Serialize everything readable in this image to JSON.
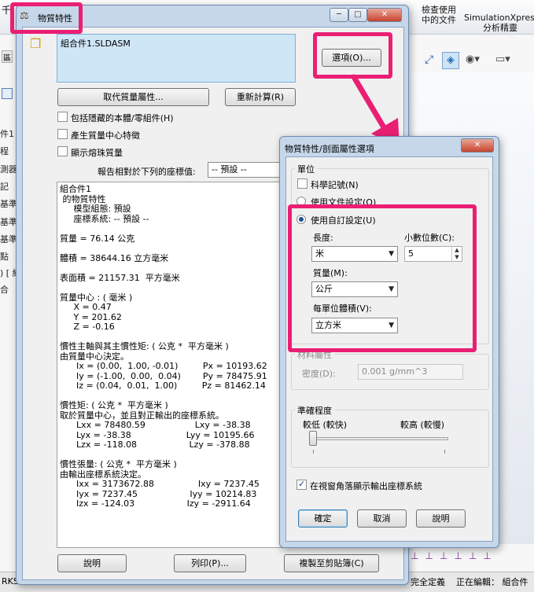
{
  "background_app": {
    "ribbon": {
      "left_partial": "千",
      "check_usage": [
        "檢查使用",
        "中的文件"
      ],
      "simulation": [
        "SimulationXpress",
        "分析精靈"
      ]
    },
    "tree_items": [
      "件1 (",
      "程",
      "測器",
      "記",
      "基準",
      "基準",
      "基準",
      "點",
      ") [ 組",
      "合"
    ],
    "status": {
      "left": "RKS",
      "fully_defined": "完全定義",
      "editing": "正在編輯：  組合件"
    },
    "left_tab": "區"
  },
  "mass_props": {
    "title": "物質特性",
    "document_name": "組合件1.SLDASM",
    "options_button": "選項(O)...",
    "override_button": "取代質量屬性...",
    "recalc_button": "重新計算(R)",
    "checkboxes": [
      {
        "label": "包括隱藏的本體/零組件(H)",
        "checked": false
      },
      {
        "label": "產生質量中心特徵",
        "checked": false
      },
      {
        "label": "顯示熔珠質量",
        "checked": false
      }
    ],
    "report_label": "報告相對於下列的座標值:",
    "coord_value": "-- 預設 --",
    "results": [
      "組合件1",
      " 的物質特性",
      "     模型組態: 預設",
      "     座標系統: -- 預設 --",
      "",
      "質量 = 76.14 公克",
      "",
      "體積 = 38644.16 立方毫米",
      "",
      "表面積 = 21157.31  平方毫米",
      "",
      "質量中心 : ( 毫米 )",
      "     X = 0.47",
      "     Y = 201.62",
      "     Z = -0.16",
      "",
      "慣性主軸與其主慣性矩: ( 公克 *  平方毫米 )",
      "由質量中心決定。",
      "      Ix = (0.00,  1.00, -0.01)         Px = 10193.62",
      "      Iy = (-1.00,  0.00,  0.04)        Py = 78475.91",
      "      Iz = (0.04,  0.01,  1.00)         Pz = 81462.14",
      "",
      "慣性矩: ( 公克 *  平方毫米 )",
      "取於質量中心，並且對正輸出的座標系統。",
      "      Lxx = 78480.59                  Lxy = -38.38",
      "      Lyx = -38.38                    Lyy = 10195.66",
      "      Lzx = -118.08                   Lzy = -378.88",
      "",
      "慣性張量: ( 公克 *  平方毫米 )",
      "由輸出座標系統決定。",
      "      Ixx = 3173672.88                Ixy = 7237.45",
      "      Iyx = 7237.45                   Iyy = 10214.83",
      "      Izx = -124.03                   Izy = -2911.64"
    ],
    "help_button": "說明",
    "print_button": "列印(P)...",
    "copy_button": "複製至剪貼簿(C)"
  },
  "options_dialog": {
    "title": "物質特性/剖面屬性選項",
    "units_group": "單位",
    "sci_notation": {
      "label": "科學記號(N)",
      "checked": false
    },
    "use_doc_settings": {
      "label": "使用文件設定(O)",
      "selected": false
    },
    "use_custom": {
      "label": "使用自訂設定(U)",
      "selected": true
    },
    "length_label": "長度:",
    "length_value": "米",
    "decimals_label": "小數位數(C):",
    "decimals_value": "5",
    "mass_label": "質量(M):",
    "mass_value": "公斤",
    "volume_label": "每單位體積(V):",
    "volume_value": "立方米",
    "material_group": "材料屬性",
    "density_label": "密度(D):",
    "density_value": "0.001 g/mm^3",
    "accuracy_group": "準確程度",
    "lower_label": "較低 (較快)",
    "higher_label": "較高 (較慢)",
    "accuracy_level": 0.0,
    "show_coord": {
      "label": "在視窗角落顯示輸出座標系統",
      "checked": true
    },
    "ok_button": "確定",
    "cancel_button": "取消",
    "help_button": "說明"
  },
  "colors": {
    "highlight": "#ea1f74",
    "window_frame": "#c6d7ea",
    "list_bg": "#cfe6f7"
  }
}
